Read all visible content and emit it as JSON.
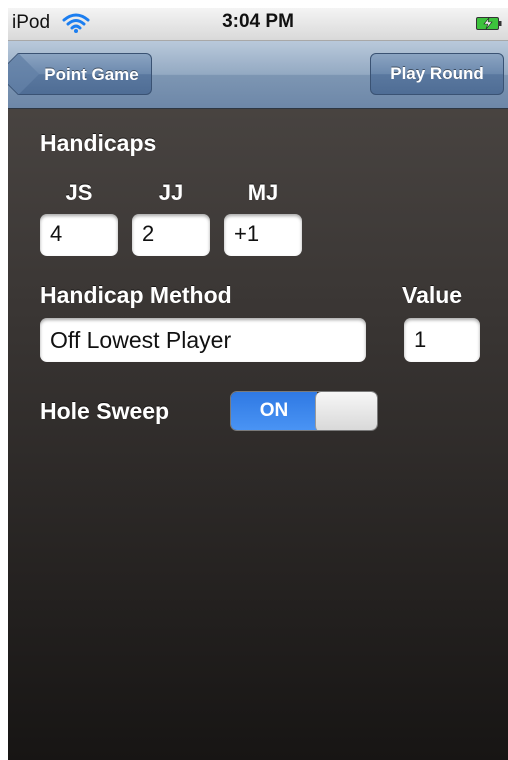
{
  "status_bar": {
    "carrier": "iPod",
    "time": "3:04 PM",
    "icons": [
      "wifi-icon",
      "battery-charging-icon"
    ]
  },
  "nav_bar": {
    "back_label": "Point Game",
    "right_label": "Play Round"
  },
  "handicaps": {
    "title": "Handicaps",
    "players": [
      {
        "name": "JS",
        "value": "4"
      },
      {
        "name": "JJ",
        "value": "2"
      },
      {
        "name": "MJ",
        "value": "+1"
      }
    ]
  },
  "handicap_method": {
    "label": "Handicap Method",
    "value": "Off Lowest Player"
  },
  "value_field": {
    "label": "Value",
    "value": "1"
  },
  "hole_sweep": {
    "label": "Hole Sweep",
    "state": "ON"
  },
  "colors": {
    "nav_bar": "#7d96b3",
    "toggle_on": "#3a86ec",
    "background_top": "#4f4a47",
    "background_bottom": "#171514"
  }
}
